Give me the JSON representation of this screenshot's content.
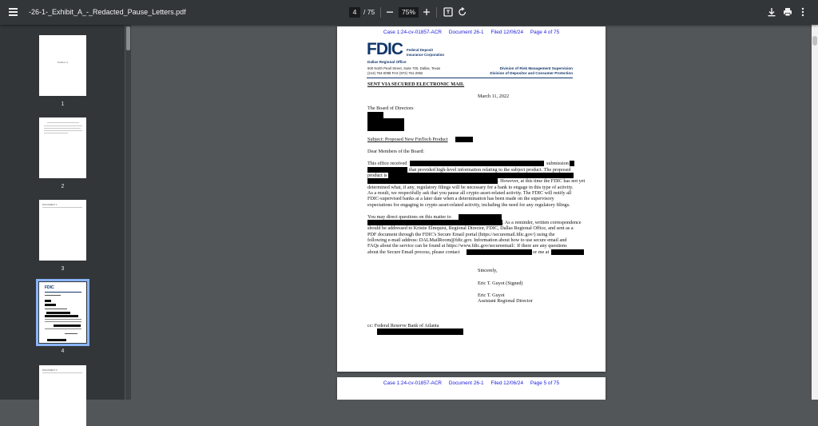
{
  "toolbar": {
    "title": "-26-1-_Exhibit_A_-_Redacted_Pause_Letters.pdf",
    "current_page": "4",
    "total_pages": "/ 75",
    "zoom": "75%",
    "icons": [
      "menu-icon",
      "zoom-out-icon",
      "zoom-in-icon",
      "fit-page-icon",
      "rotate-icon",
      "download-icon",
      "print-icon",
      "more-icon"
    ]
  },
  "thumbnails": [
    {
      "label": "1",
      "text": "Exhibit A"
    },
    {
      "label": "2",
      "text": ""
    },
    {
      "label": "3",
      "text": "DOCUMENT 1"
    },
    {
      "label": "4",
      "text": "FDIC"
    },
    {
      "label": "5",
      "text": "DOCUMENT 3"
    }
  ],
  "page4": {
    "header": "Case 1:24-cv-01857-ACR     Document 26-1     Filed 12/06/24     Page 4 of 75",
    "logo": "FDIC",
    "logo_sub1": "Federal Deposit",
    "logo_sub2": "Insurance Corporation",
    "office": "Dallas Regional Office",
    "address1": "600 North Pearl Street, Suite 700, Dallas, Texas",
    "address2": "(214) 754-0098     FAX (972) 761-2082",
    "division1": "Division of Risk Management Supervision",
    "division2": "Division of Depositor and Consumer Protection",
    "sent_via": "SENT VIA SECURED ELECTRONIC MAIL",
    "date": "March 11, 2022",
    "recipient": "The Board of Directors",
    "subject": "Subject:  Proposed New FinTech Product",
    "salutation": "Dear Members of the Board:",
    "p1_l1a": "This office received",
    "p1_l1b": "submission",
    "p1_l2": "that provided high-level information relating to the subject product.  The proposed",
    "p1_l3": "product is",
    "p1_l4": ".  However, at this time the FDIC has not yet",
    "p1_l5": "determined what, if any, regulatory filings will be necessary for a bank to engage in this type of activity.",
    "p1_l6": "As a result, we respectfully ask that you pause all crypto asset-related activity.  The FDIC will notify all",
    "p1_l7": "FDIC-supervised banks at a later date when a determination has been made on the supervisory",
    "p1_l8": "expectations for engaging in crypto asset-related activity, including the need for any regulatory filings.",
    "p2_l1": "You may direct questions on this matter to",
    "p2_l2": ".  As a reminder, written correspondence",
    "p2_l3": "should be addressed to Kristie Elmquist, Regional Director, FDIC, Dallas Regional Office, and sent as a",
    "p2_l4": "PDF document through the FDIC's Secure Email portal (https://securemail.fdic.gov/) using the",
    "p2_l5": "following e-mail address: DALMailRoom@fdic.gov.  Information about how to use secure email and",
    "p2_l6": "FAQs about the service can be found at https://www.fdic.gov/secureemail/.  If there are any questions",
    "p2_l7a": "about the Secure Email process, please contact",
    "p2_l7b": "or me at",
    "closing": "Sincerely,",
    "signer_signed": "Eric T. Guyot (Signed)",
    "signer_name": "Eric T. Guyot",
    "signer_title": "Assistant Regional Director",
    "cc": "cc:  Federal Reserve Bank of Atlanta"
  },
  "page5": {
    "header": "Case 1:24-cv-01857-ACR     Document 26-1     Filed 12/06/24     Page 5 of 75"
  }
}
